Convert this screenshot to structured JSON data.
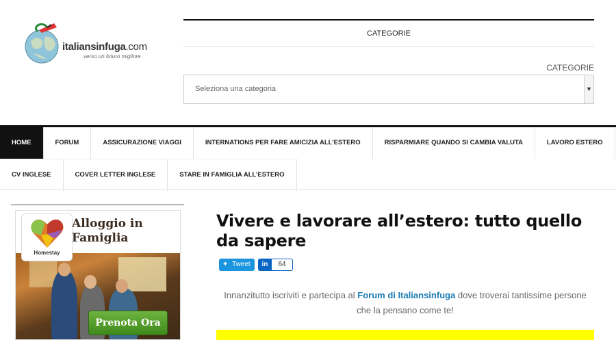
{
  "logo": {
    "brand_bold": "italiansinfuga",
    "brand_suffix": ".com",
    "tagline": "verso un futuro migliore"
  },
  "categories": {
    "heading": "CATEGORIE",
    "label": "CATEGORIE",
    "select_placeholder": "Seleziona una categoria"
  },
  "nav": {
    "row1": [
      "HOME",
      "FORUM",
      "ASSICURAZIONE VIAGGI",
      "INTERNATIONS PER FARE AMICIZIA ALL’ESTERO",
      "RISPARMIARE QUANDO SI CAMBIA VALUTA",
      "LAVORO ESTERO"
    ],
    "row2": [
      "CV INGLESE",
      "COVER LETTER INGLESE",
      "STARE IN FAMIGLIA ALL’ESTERO"
    ],
    "active": "HOME"
  },
  "ad": {
    "brand": "Homestay",
    "title_line1": "Alloggio in",
    "title_line2": "Famiglia",
    "button": "Prenota Ora"
  },
  "article": {
    "title": "Vivere e lavorare all’estero: tutto quello da sapere",
    "tweet_label": "Tweet",
    "linkedin_label": "in",
    "linkedin_count": "64",
    "intro_before": "Innanzitutto iscriviti e partecipa al ",
    "intro_link": "Forum di Italiansinfuga",
    "intro_after": " dove troverai tantissime persone che la pensano come te!"
  },
  "colors": {
    "nav_active_bg": "#111111",
    "link": "#1a7ab5",
    "tweet": "#1b95e0",
    "linkedin": "#0a66c2",
    "highlight": "#ffff00",
    "ad_button": "#4f9e2b"
  }
}
